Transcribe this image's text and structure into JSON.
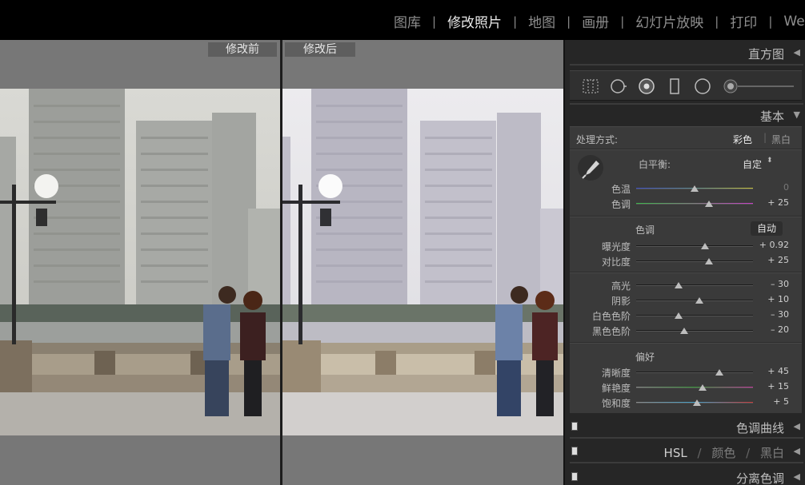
{
  "modules": [
    {
      "label": "图库"
    },
    {
      "label": "修改照片",
      "active": true
    },
    {
      "label": "地图"
    },
    {
      "label": "画册"
    },
    {
      "label": "幻灯片放映"
    },
    {
      "label": "打印"
    },
    {
      "label": "We"
    }
  ],
  "viewer": {
    "before_label": "修改前",
    "after_label": "修改后"
  },
  "panel": {
    "histogram_title": "直方图",
    "basic_title": "基本",
    "treatment": {
      "label": "处理方式:",
      "color": "彩色",
      "bw": "黑白"
    },
    "white_balance": {
      "label": "白平衡:",
      "value": "自定"
    },
    "wb_sliders": [
      {
        "label": "色温",
        "value": "0",
        "pos": 0.5
      },
      {
        "label": "色调",
        "value": "+ 25",
        "pos": 0.62
      }
    ],
    "tone": {
      "title": "色调",
      "auto": "自动"
    },
    "tone_sliders_a": [
      {
        "label": "曝光度",
        "value": "+ 0.92",
        "pos": 0.59
      },
      {
        "label": "对比度",
        "value": "+ 25",
        "pos": 0.62
      }
    ],
    "tone_sliders_b": [
      {
        "label": "高光",
        "value": "– 30",
        "pos": 0.36
      },
      {
        "label": "阴影",
        "value": "+ 10",
        "pos": 0.54
      },
      {
        "label": "白色色阶",
        "value": "– 30",
        "pos": 0.36
      },
      {
        "label": "黑色色阶",
        "value": "– 20",
        "pos": 0.41
      }
    ],
    "presence": {
      "title": "偏好"
    },
    "presence_sliders": [
      {
        "label": "清晰度",
        "value": "+ 45",
        "pos": 0.71
      },
      {
        "label": "鲜艳度",
        "value": "+ 15",
        "pos": 0.57
      },
      {
        "label": "饱和度",
        "value": "+ 5",
        "pos": 0.52
      }
    ],
    "tone_curve_title": "色调曲线",
    "hsl": {
      "hsl": "HSL",
      "color": "颜色",
      "bw": "黑白"
    },
    "split_toning_title": "分离色调"
  },
  "colors": {
    "accent_active": "#e8e8e8",
    "panel_bg": "#3a3a3a"
  }
}
